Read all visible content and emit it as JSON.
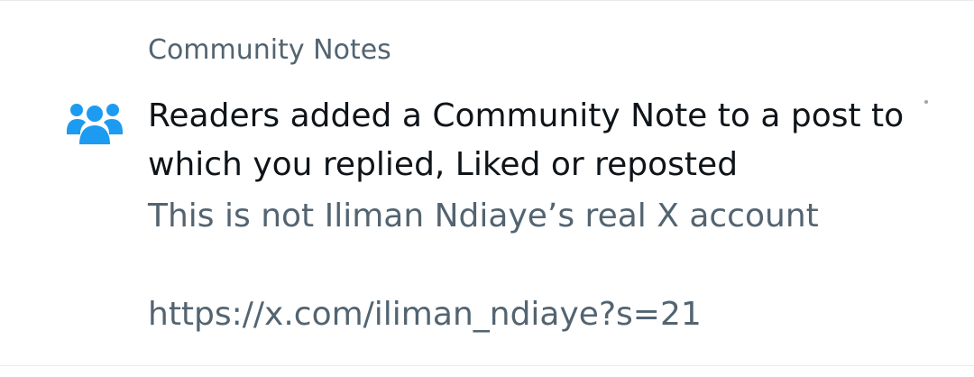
{
  "notification": {
    "header": "Community Notes",
    "headline": "Readers added a Community Note to a post to which you replied, Liked or reposted",
    "note_text": "This is not Iliman Ndiaye’s real X account",
    "note_link": "https://x.com/iliman_ndiaye?s=21",
    "icon": "community-notes-people-icon"
  },
  "colors": {
    "icon_blue": "#1d9bf0",
    "primary_text": "#0f1419",
    "secondary_text": "#536471",
    "divider": "#e7eaec"
  }
}
